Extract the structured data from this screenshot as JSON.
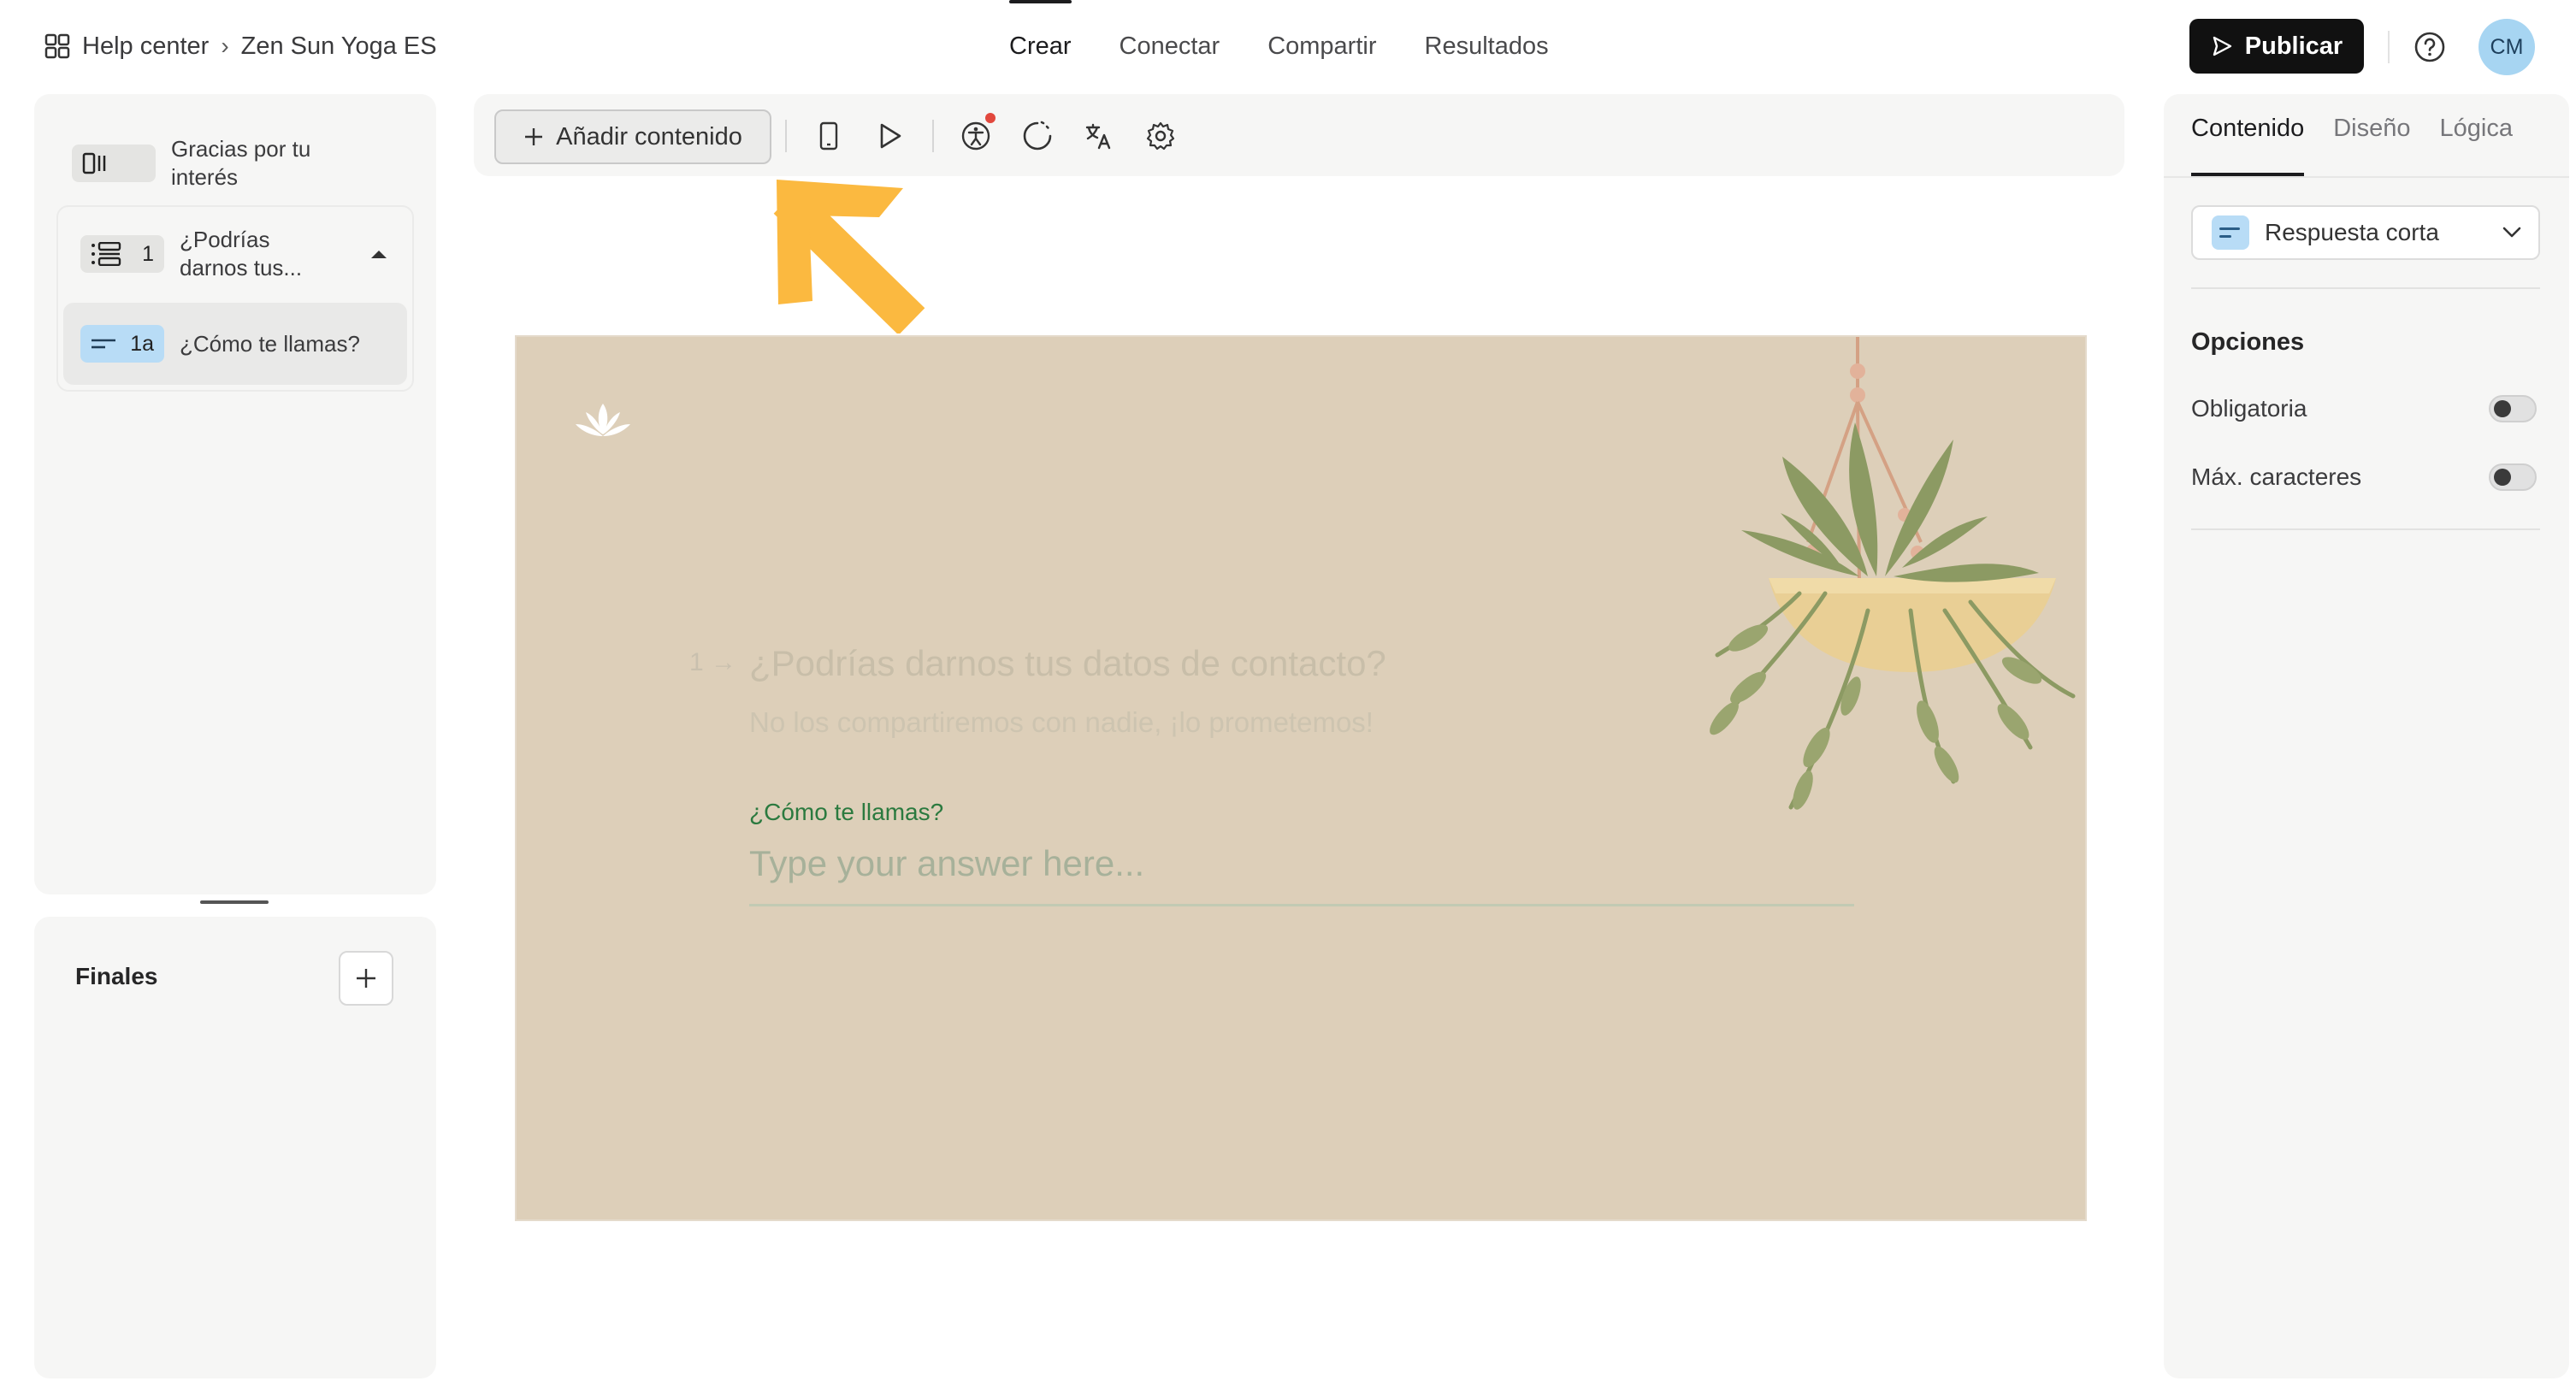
{
  "breadcrumb": {
    "home": "Help center",
    "current": "Zen Sun Yoga ES"
  },
  "topnav": {
    "tabs": [
      "Crear",
      "Conectar",
      "Compartir",
      "Resultados"
    ],
    "active": "Crear"
  },
  "header": {
    "publish_label": "Publicar",
    "avatar_initials": "CM"
  },
  "sidebar": {
    "items": [
      {
        "label": "Gracias por tu interés",
        "badge": ""
      },
      {
        "label": "¿Podrías darnos tus...",
        "badge": "1"
      },
      {
        "label": "¿Cómo te llamas?",
        "badge": "1a"
      }
    ],
    "finales_label": "Finales"
  },
  "toolbar": {
    "add_content_label": "Añadir contenido"
  },
  "canvas": {
    "question_number": "1",
    "question_title": "¿Podrías darnos tus datos de contacto?",
    "question_description": "No los compartiremos con nadie, ¡lo prometemos!",
    "field_label": "¿Cómo te llamas?",
    "answer_placeholder": "Type your answer here...",
    "colors": {
      "background": "#ddcfb9",
      "label": "#2b7a3f",
      "accent_arrow": "#fbb940"
    }
  },
  "right_panel": {
    "tabs": [
      "Contenido",
      "Diseño",
      "Lógica"
    ],
    "active_tab": "Contenido",
    "question_type": "Respuesta corta",
    "options_title": "Opciones",
    "options": [
      {
        "label": "Obligatoria",
        "enabled": false
      },
      {
        "label": "Máx. caracteres",
        "enabled": false
      }
    ]
  }
}
